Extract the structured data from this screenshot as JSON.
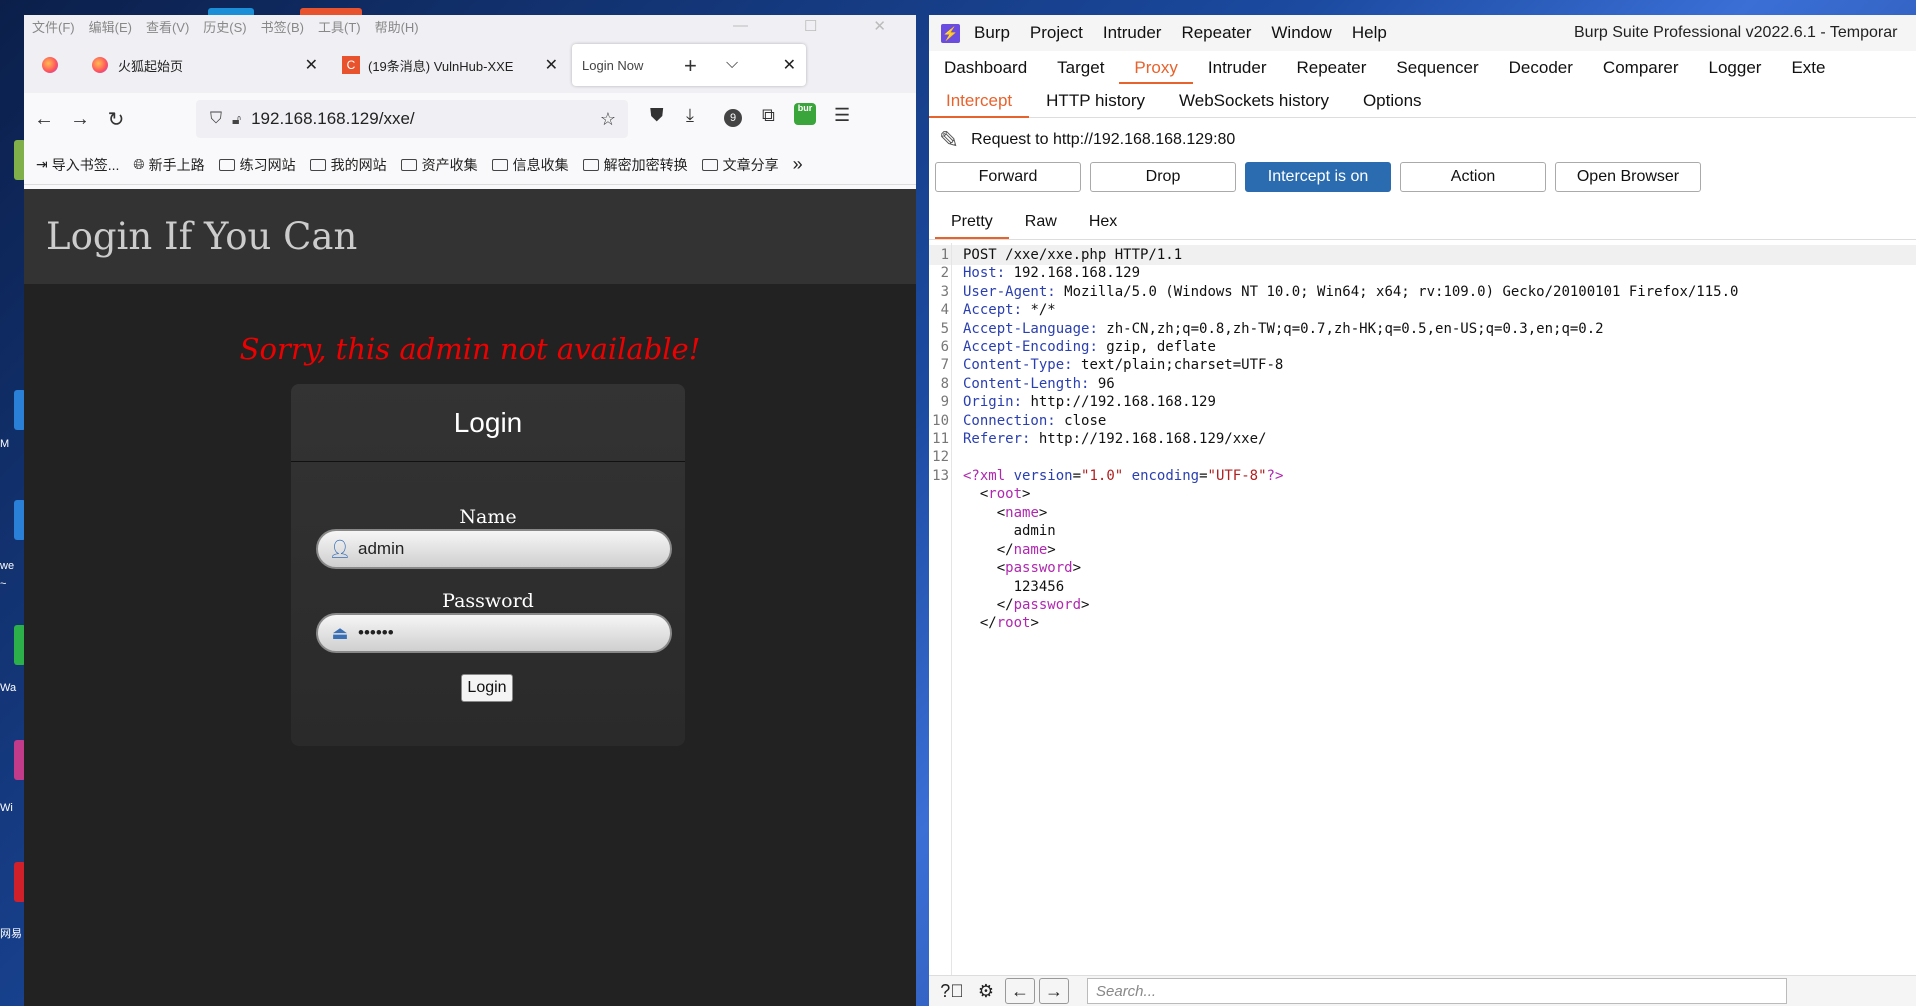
{
  "desktop": {
    "labels": [
      "M",
      "we",
      "~",
      "Wa",
      "Wi",
      "网易"
    ]
  },
  "firefox": {
    "menu": [
      "文件(F)",
      "编辑(E)",
      "查看(V)",
      "历史(S)",
      "书签(B)",
      "工具(T)",
      "帮助(H)"
    ],
    "tabs": [
      {
        "label": "火狐起始页"
      },
      {
        "label": "(19条消息) VulnHub-XXE"
      },
      {
        "label": "Login Now"
      }
    ],
    "url": "192.168.168.129/xxe/",
    "downloads_badge": "9",
    "extension_label": "bur",
    "bookmarks": [
      "导入书签...",
      "新手上路",
      "练习网站",
      "我的网站",
      "资产收集",
      "信息收集",
      "解密加密转换",
      "文章分享"
    ],
    "page": {
      "site_title": "Login If You Can",
      "error": "Sorry, this admin not available!",
      "form_title": "Login",
      "name_label": "Name",
      "name_value": "admin",
      "password_label": "Password",
      "password_value": "••••••",
      "submit": "Login"
    }
  },
  "burp": {
    "menu": [
      "Burp",
      "Project",
      "Intruder",
      "Repeater",
      "Window",
      "Help"
    ],
    "title": "Burp Suite Professional v2022.6.1 - Temporar",
    "tabs": [
      "Dashboard",
      "Target",
      "Proxy",
      "Intruder",
      "Repeater",
      "Sequencer",
      "Decoder",
      "Comparer",
      "Logger",
      "Exte"
    ],
    "subtabs": [
      "Intercept",
      "HTTP history",
      "WebSockets history",
      "Options"
    ],
    "request_to": "Request to http://192.168.168.129:80",
    "buttons": [
      "Forward",
      "Drop",
      "Intercept is on",
      "Action",
      "Open Browser"
    ],
    "view_tabs": [
      "Pretty",
      "Raw",
      "Hex"
    ],
    "request": {
      "line1": "POST /xxe/xxe.php HTTP/1.1",
      "headers": [
        {
          "k": "Host",
          "v": "192.168.168.129"
        },
        {
          "k": "User-Agent",
          "v": "Mozilla/5.0 (Windows NT 10.0; Win64; x64; rv:109.0) Gecko/20100101 Firefox/115.0"
        },
        {
          "k": "Accept",
          "v": "*/*"
        },
        {
          "k": "Accept-Language",
          "v": "zh-CN,zh;q=0.8,zh-TW;q=0.7,zh-HK;q=0.5,en-US;q=0.3,en;q=0.2"
        },
        {
          "k": "Accept-Encoding",
          "v": "gzip, deflate"
        },
        {
          "k": "Content-Type",
          "v": "text/plain;charset=UTF-8"
        },
        {
          "k": "Content-Length",
          "v": "96"
        },
        {
          "k": "Origin",
          "v": "http://192.168.168.129"
        },
        {
          "k": "Connection",
          "v": "close"
        },
        {
          "k": "Referer",
          "v": "http://192.168.168.129/xxe/"
        }
      ],
      "xml_decl": {
        "version": "1.0",
        "encoding": "UTF-8"
      },
      "root_tag": "root",
      "name_tag": "name",
      "name_value": "admin",
      "password_tag": "password",
      "password_value": "123456"
    },
    "search_placeholder": "Search..."
  }
}
